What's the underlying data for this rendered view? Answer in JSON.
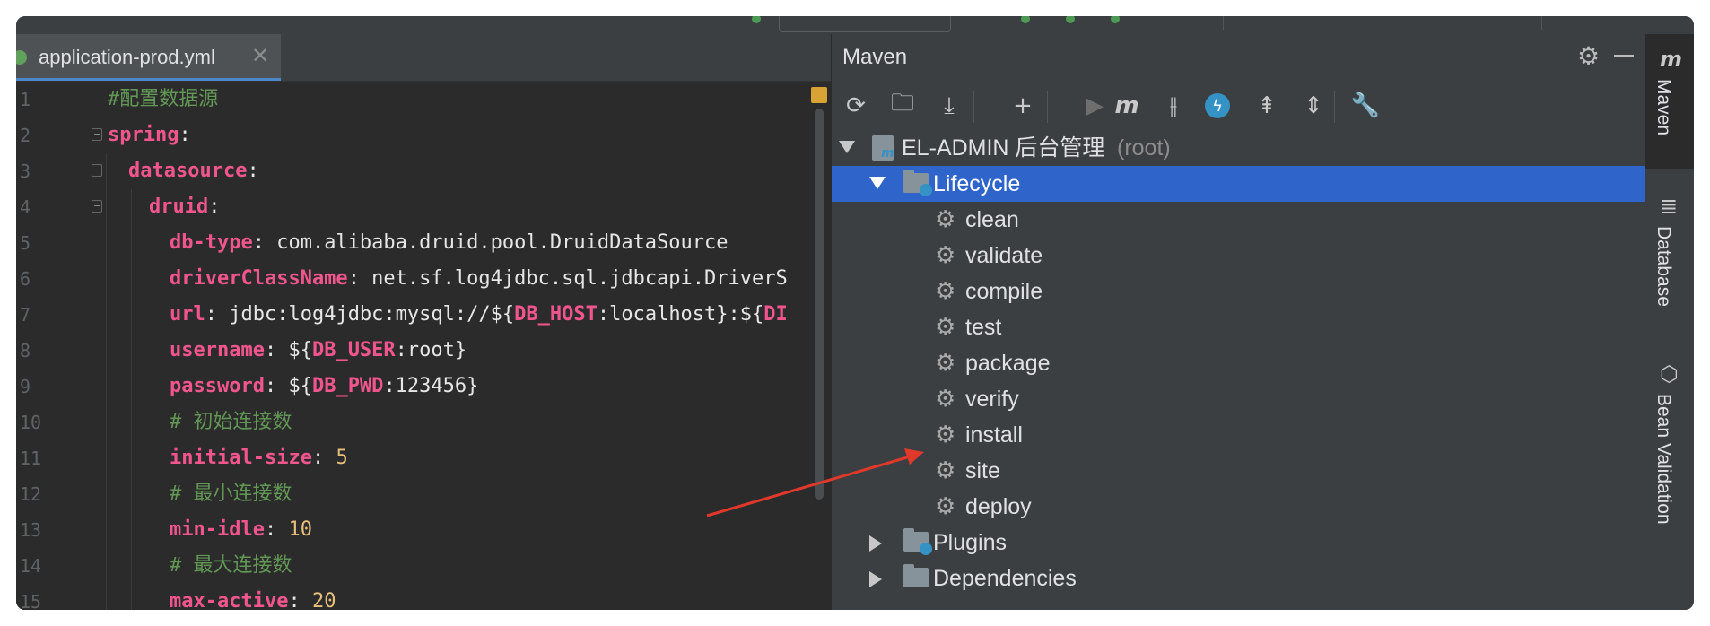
{
  "editor": {
    "tab": {
      "label": "application-prod.yml",
      "close": "✕"
    },
    "lines": [
      {
        "num": "1",
        "parts": [
          [
            "c",
            "#配置数据源"
          ]
        ]
      },
      {
        "num": "2",
        "parts": [
          [
            "k",
            "spring"
          ],
          [
            "t",
            ":"
          ]
        ]
      },
      {
        "num": "3",
        "parts": [
          [
            "k",
            "datasource"
          ],
          [
            "t",
            ":"
          ]
        ]
      },
      {
        "num": "4",
        "parts": [
          [
            "k",
            "druid"
          ],
          [
            "t",
            ":"
          ]
        ]
      },
      {
        "num": "5",
        "parts": [
          [
            "k",
            "db-type"
          ],
          [
            "t",
            ": com.alibaba.druid.pool.DruidDataSource"
          ]
        ]
      },
      {
        "num": "6",
        "parts": [
          [
            "k",
            "driverClassName"
          ],
          [
            "t",
            ": net.sf.log4jdbc.sql.jdbcapi.DriverS"
          ]
        ]
      },
      {
        "num": "7",
        "parts": [
          [
            "k",
            "url"
          ],
          [
            "t",
            ": jdbc:log4jdbc:mysql://${"
          ],
          [
            "v",
            "DB_HOST"
          ],
          [
            "t",
            ":localhost}:${"
          ],
          [
            "v",
            "DI"
          ]
        ]
      },
      {
        "num": "8",
        "parts": [
          [
            "k",
            "username"
          ],
          [
            "t",
            ": ${"
          ],
          [
            "v",
            "DB_USER"
          ],
          [
            "t",
            ":root}"
          ]
        ]
      },
      {
        "num": "9",
        "parts": [
          [
            "k",
            "password"
          ],
          [
            "t",
            ": ${"
          ],
          [
            "v",
            "DB_PWD"
          ],
          [
            "t",
            ":123456}"
          ]
        ]
      },
      {
        "num": "10",
        "parts": [
          [
            "c",
            "# 初始连接数"
          ]
        ]
      },
      {
        "num": "11",
        "parts": [
          [
            "k",
            "initial-size"
          ],
          [
            "t",
            ": "
          ],
          [
            "n",
            "5"
          ]
        ]
      },
      {
        "num": "12",
        "parts": [
          [
            "c",
            "# 最小连接数"
          ]
        ]
      },
      {
        "num": "13",
        "parts": [
          [
            "k",
            "min-idle"
          ],
          [
            "t",
            ": "
          ],
          [
            "n",
            "10"
          ]
        ]
      },
      {
        "num": "14",
        "parts": [
          [
            "c",
            "# 最大连接数"
          ]
        ]
      },
      {
        "num": "15",
        "parts": [
          [
            "k",
            "max-active"
          ],
          [
            "t",
            ": "
          ],
          [
            "n",
            "20"
          ]
        ]
      }
    ]
  },
  "maven": {
    "title": "Maven",
    "toolbar": [
      {
        "name": "reload-icon",
        "glyph": "⟳"
      },
      {
        "name": "generate-sources-icon",
        "glyph": "🗀"
      },
      {
        "name": "download-icon",
        "glyph": "⤓"
      },
      {
        "name": "sep"
      },
      {
        "name": "add-icon",
        "glyph": "+"
      },
      {
        "name": "sep"
      },
      {
        "name": "run-icon",
        "glyph": "▶"
      },
      {
        "name": "execute-goal-icon",
        "glyph": "m"
      },
      {
        "name": "toggle-offline-icon",
        "glyph": "⫲"
      },
      {
        "name": "skip-tests-icon",
        "glyph": "ϟ"
      },
      {
        "name": "show-dependencies-icon",
        "glyph": "⇞"
      },
      {
        "name": "collapse-all-icon",
        "glyph": "⇕"
      },
      {
        "name": "sep"
      },
      {
        "name": "settings-wrench-icon",
        "glyph": "🔧"
      }
    ],
    "root": {
      "label": "EL-ADMIN 后台管理",
      "suffix": "(root)"
    },
    "lifecycle": {
      "label": "Lifecycle"
    },
    "goals": [
      "clean",
      "validate",
      "compile",
      "test",
      "package",
      "verify",
      "install",
      "site",
      "deploy"
    ],
    "plugins": {
      "label": "Plugins"
    },
    "dependencies": {
      "label": "Dependencies"
    }
  },
  "side_strip": {
    "maven": "Maven",
    "database": "Database",
    "bean_validation": "Bean Validation"
  },
  "colors": {
    "key": "#f0568c",
    "comment": "#629755",
    "number": "#e6c07b",
    "selection": "#2f65ca",
    "annotation": "#e0392b"
  }
}
